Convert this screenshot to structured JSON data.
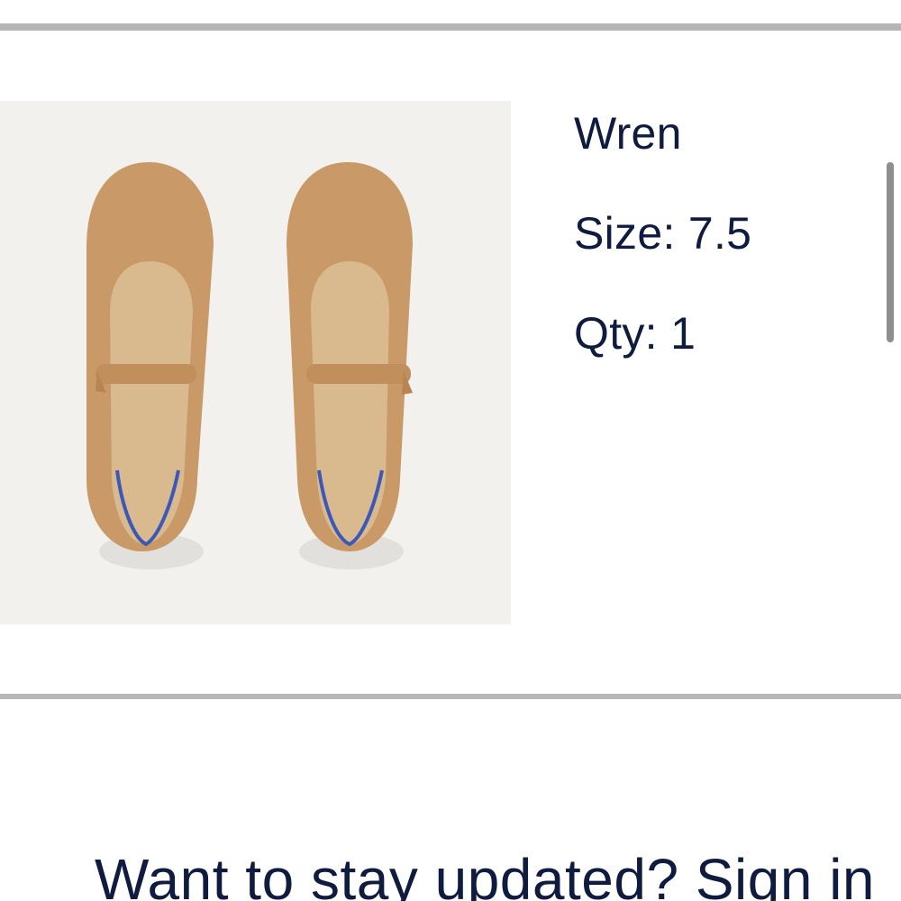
{
  "cart_item": {
    "product_name": "Wren",
    "size_text": "Size: 7.5",
    "qty_text": "Qty: 1",
    "colors": {
      "shoe_body": "#c99a67",
      "insole": "#d9b98e",
      "accent_heel": "#3c58b8",
      "image_background": "#f2f1ee"
    }
  },
  "signup": {
    "prompt_text": "Want to stay updated? Sign in"
  },
  "colors": {
    "text": "#0f1c3f",
    "divider": "#b5b5b5",
    "scrollbar": "#8e8e8e"
  }
}
